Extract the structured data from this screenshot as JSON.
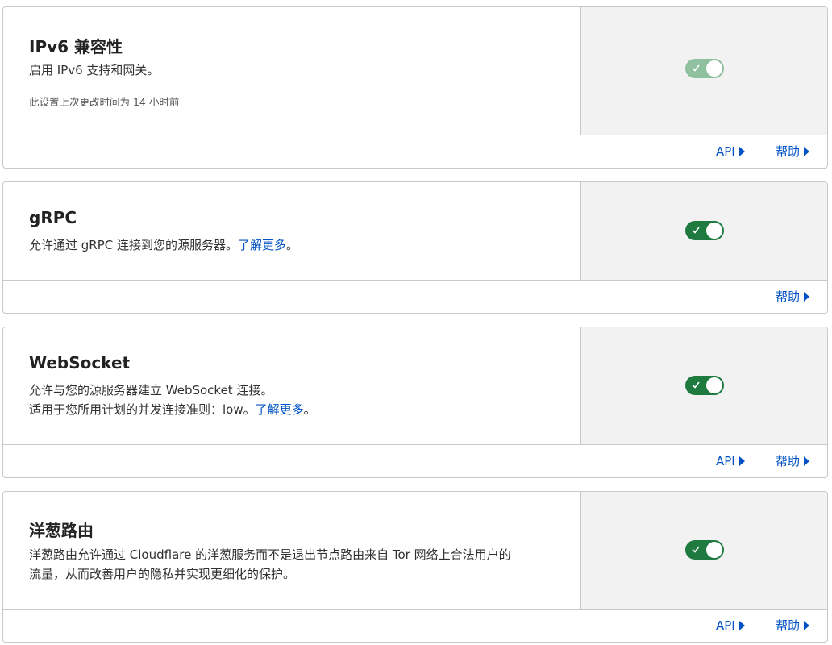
{
  "cards": [
    {
      "title": "IPv6 兼容性",
      "description": "启用 IPv6 支持和网关。",
      "meta": "此设置上次更改时间为 14 小时前",
      "toggle_on": true,
      "toggle_disabled": true,
      "footer": {
        "api_label": "API",
        "help_label": "帮助"
      }
    },
    {
      "title": "gRPC",
      "description": "允许通过 gRPC 连接到您的源服务器。",
      "learn_more": "了解更多",
      "learn_more_suffix": "。",
      "toggle_on": true,
      "footer": {
        "help_label": "帮助"
      }
    },
    {
      "title": "WebSocket",
      "description_line1": "允许与您的源服务器建立 WebSocket 连接。",
      "description_line2": "适用于您所用计划的并发连接准则：low。",
      "learn_more": "了解更多",
      "learn_more_suffix": "。",
      "toggle_on": true,
      "footer": {
        "api_label": "API",
        "help_label": "帮助"
      }
    },
    {
      "title": "洋葱路由",
      "description_line1": "洋葱路由允许通过 Cloudflare 的洋葱服务而不是退出节点路由来自 Tor 网络上合法用户的",
      "description_line2": "流量，从而改善用户的隐私并实现更细化的保护。",
      "toggle_on": true,
      "footer": {
        "api_label": "API",
        "help_label": "帮助"
      }
    }
  ],
  "colors": {
    "toggle_on": "#1e7a3f",
    "toggle_disabled": "#8fc0a0",
    "link": "#0051c3",
    "control_bg": "#f2f2f2"
  },
  "icons": {
    "toggle_check": "check-icon",
    "footer_arrow": "caret-right-icon"
  }
}
